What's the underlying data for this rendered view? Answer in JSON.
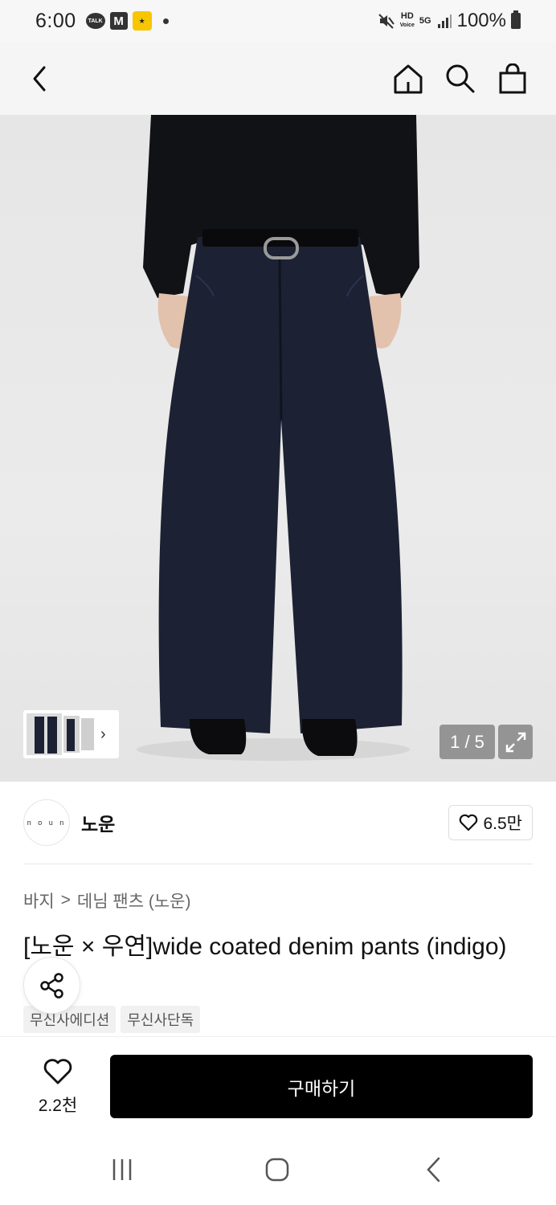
{
  "status_bar": {
    "time": "6:00",
    "talk_label": "TALK",
    "m_label": "M",
    "coupang_label": "★",
    "hd_label": "HD",
    "voice_label": "Voice",
    "network": "5G",
    "battery": "100%"
  },
  "header": {
    "icons": [
      "back-icon",
      "home-icon",
      "search-icon",
      "shopping-bag-icon"
    ]
  },
  "gallery": {
    "counter": "1 / 5",
    "thumb_more": "›"
  },
  "brand": {
    "logo_text": "n o u n",
    "name": "노운",
    "likes": "6.5만"
  },
  "breadcrumb": {
    "category": "바지",
    "separator": ">",
    "subcategory": "데님 팬츠 (노운)"
  },
  "product": {
    "title": "[노운 × 우연]wide coated denim pants (indigo)",
    "tags": [
      "무신사에디션",
      "무신사단독"
    ]
  },
  "bottom_bar": {
    "wish_count": "2.2천",
    "buy_label": "구매하기"
  },
  "colors": {
    "buy_button": "#000000",
    "header_bg": "#f5f5f6",
    "denim": "#1c2233"
  }
}
